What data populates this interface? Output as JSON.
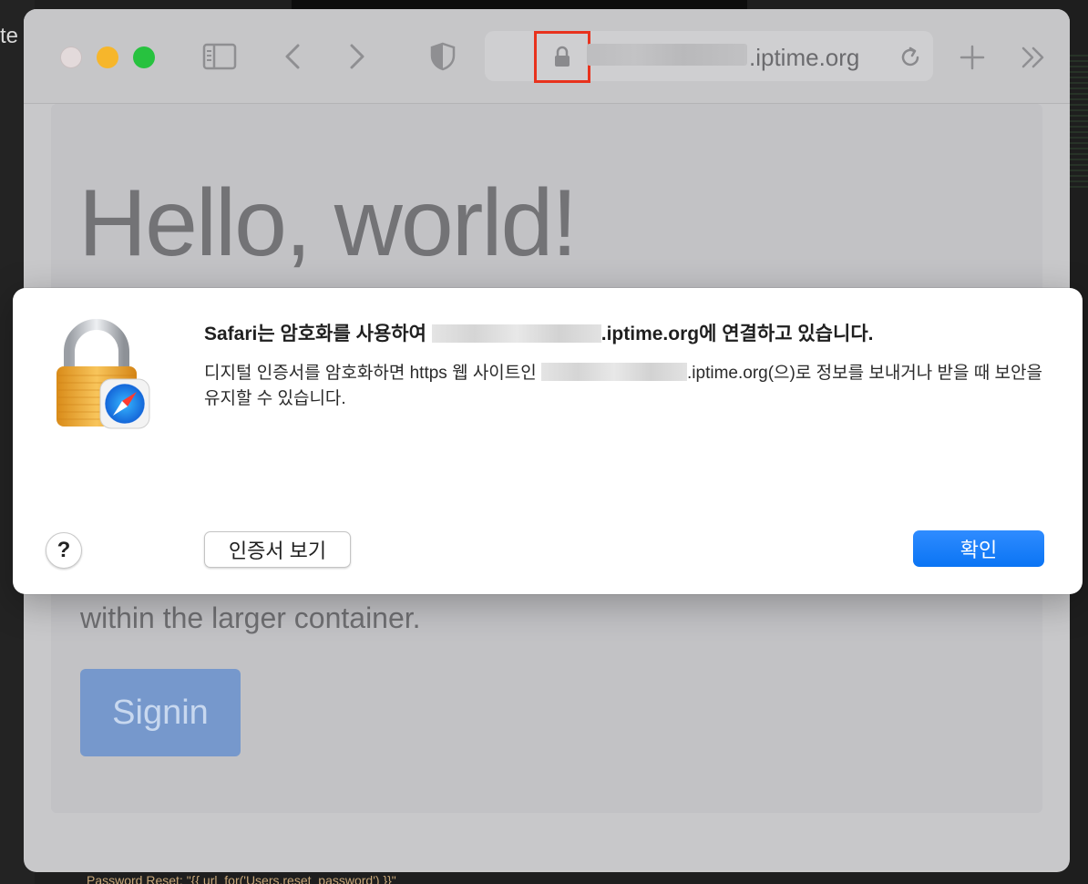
{
  "background": {
    "left_text": "te",
    "bottom_code": "Password Reset: \"{{ url_for('Users.reset_password') }}\""
  },
  "toolbar": {
    "url_domain": ".iptime.org",
    "icons": [
      "sidebar-icon",
      "back-icon",
      "forward-icon",
      "shield-icon",
      "lock-icon",
      "reload-icon",
      "new-tab-icon",
      "more-icon"
    ]
  },
  "page": {
    "heading": "Hello, world!",
    "lead": "within the larger container.",
    "signin_label": "Signin"
  },
  "dialog": {
    "title_prefix": "Safari는 암호화를 사용하여 ",
    "title_domain": ".iptime.org에 연결하고 있습니다.",
    "body_prefix": "디지털 인증서를 암호화하면 https 웹 사이트인 ",
    "body_suffix": ".iptime.org(으)로 정보를 보내거나 받을 때 보안을 유지할 수 있습니다.",
    "help_label": "?",
    "view_cert_label": "인증서 보기",
    "ok_label": "확인"
  },
  "colors": {
    "accent": "#0a74f4",
    "highlight": "#e8321d",
    "signin": "#7698cc"
  }
}
